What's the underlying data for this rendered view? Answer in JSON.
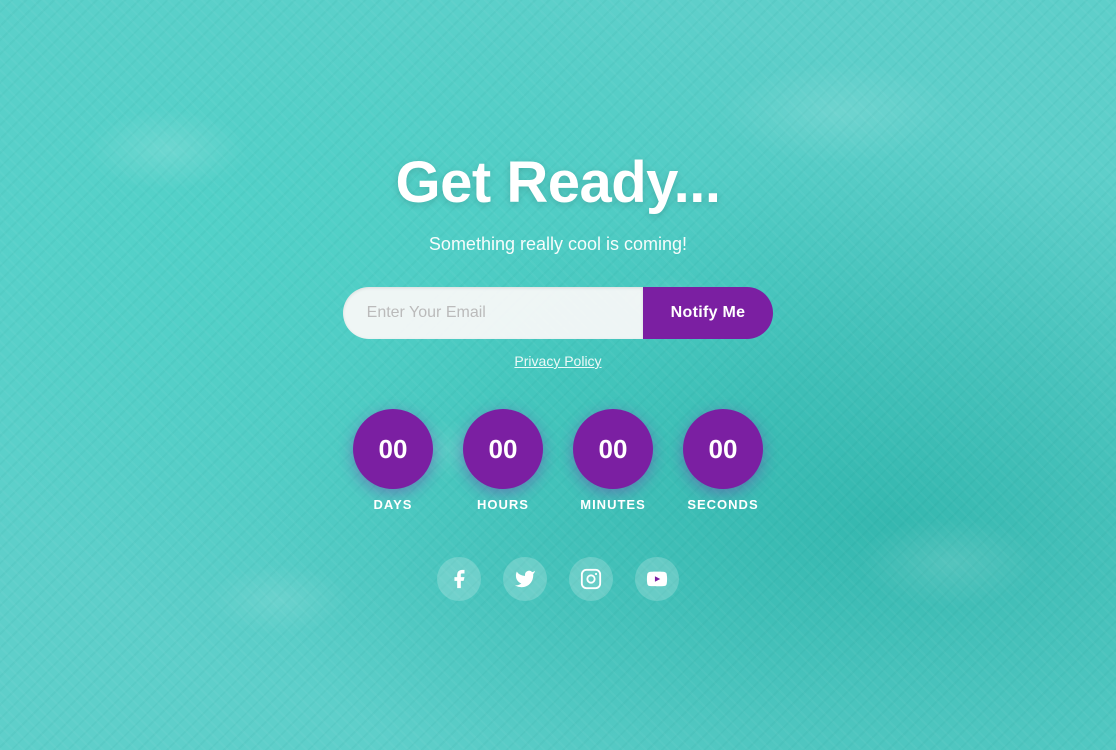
{
  "page": {
    "background_color": "#5ecfca",
    "title": "Get Ready...",
    "subtitle": "Something really cool is coming!",
    "email_input": {
      "placeholder": "Enter Your Email",
      "value": ""
    },
    "notify_button_label": "Notify Me",
    "privacy_link_label": "Privacy Policy",
    "countdown": {
      "days": {
        "value": "00",
        "label": "DAYS"
      },
      "hours": {
        "value": "00",
        "label": "HOURS"
      },
      "minutes": {
        "value": "00",
        "label": "MINUTES"
      },
      "seconds": {
        "value": "00",
        "label": "SECONDS"
      }
    },
    "social": {
      "facebook_label": "Facebook",
      "twitter_label": "Twitter",
      "instagram_label": "Instagram",
      "youtube_label": "YouTube"
    },
    "colors": {
      "purple": "#7b1fa2",
      "white": "#ffffff",
      "teal_bg": "#5ecfca"
    }
  }
}
